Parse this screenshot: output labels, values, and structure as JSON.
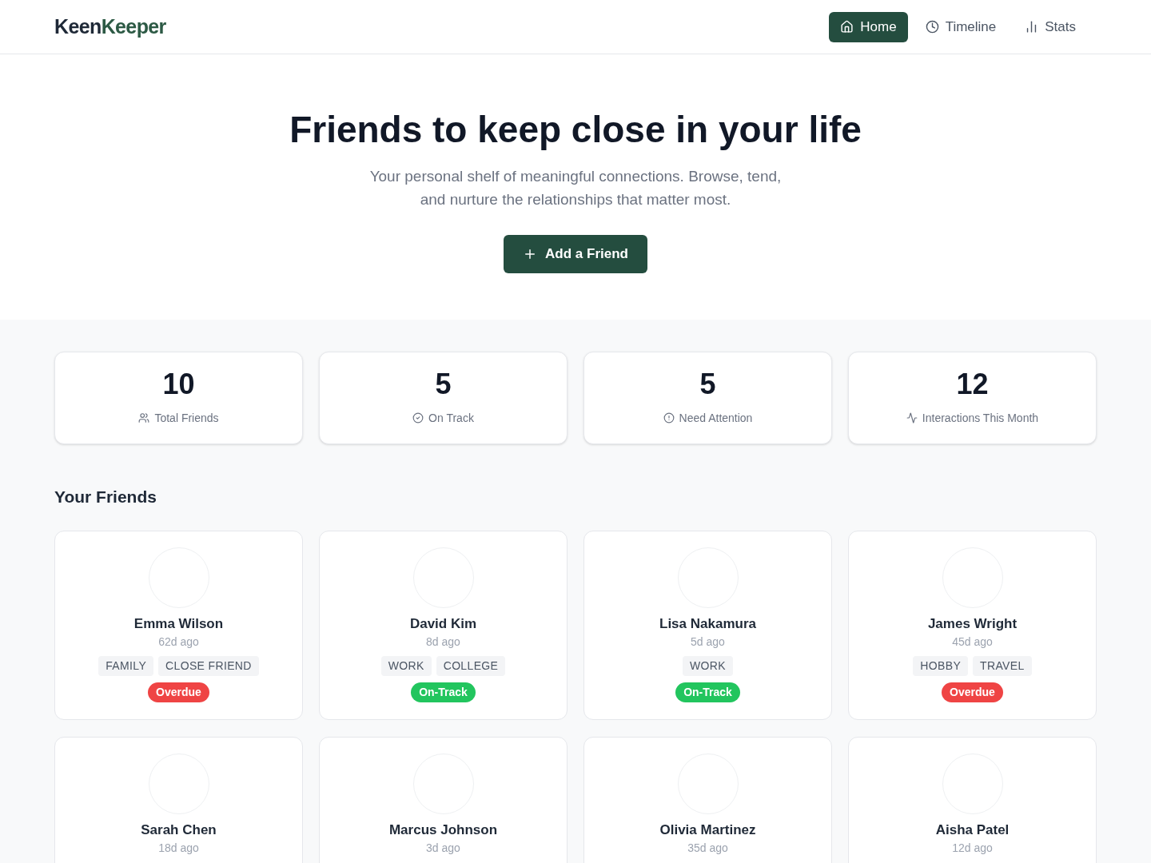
{
  "brand": {
    "part_1": "Keen",
    "part_2": "Keeper"
  },
  "nav": [
    {
      "label": "Home",
      "selected": true
    },
    {
      "label": "Timeline",
      "selected": false
    },
    {
      "label": "Stats",
      "selected": false
    }
  ],
  "hero": {
    "title": "Friends to keep close in your life",
    "subtitle": "Your personal shelf of meaningful connections. Browse, tend, and nurture the relationships that matter most.",
    "button": "Add a Friend"
  },
  "stats": [
    {
      "value": "10",
      "label": "Total Friends"
    },
    {
      "value": "5",
      "label": "On Track"
    },
    {
      "value": "5",
      "label": "Need Attention"
    },
    {
      "value": "12",
      "label": "Interactions This Month"
    }
  ],
  "friends_heading": "Your Friends",
  "friends": [
    {
      "name": "Emma Wilson",
      "last_contact": "62d ago",
      "tags": [
        "FAMILY",
        "CLOSE FRIEND"
      ],
      "status": {
        "label": "Overdue",
        "kind": "overdue"
      }
    },
    {
      "name": "David Kim",
      "last_contact": "8d ago",
      "tags": [
        "WORK",
        "COLLEGE"
      ],
      "status": {
        "label": "On-Track",
        "kind": "on-track"
      }
    },
    {
      "name": "Lisa Nakamura",
      "last_contact": "5d ago",
      "tags": [
        "WORK"
      ],
      "status": {
        "label": "On-Track",
        "kind": "on-track"
      }
    },
    {
      "name": "James Wright",
      "last_contact": "45d ago",
      "tags": [
        "HOBBY",
        "TRAVEL"
      ],
      "status": {
        "label": "Overdue",
        "kind": "overdue"
      }
    },
    {
      "name": "Sarah Chen",
      "last_contact": "18d ago"
    },
    {
      "name": "Marcus Johnson",
      "last_contact": "3d ago"
    },
    {
      "name": "Olivia Martinez",
      "last_contact": "35d ago"
    },
    {
      "name": "Aisha Patel",
      "last_contact": "12d ago"
    }
  ]
}
